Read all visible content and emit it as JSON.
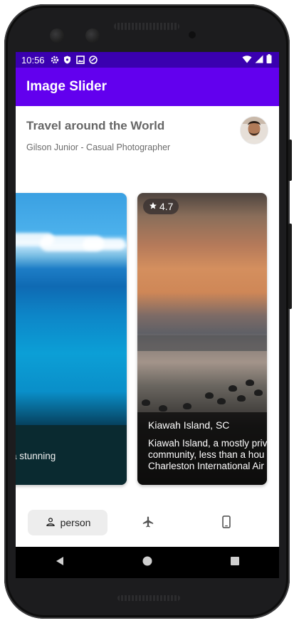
{
  "status_bar": {
    "time": "10:56",
    "icons": [
      "settings-icon",
      "shield-icon",
      "image-icon",
      "sync-icon",
      "wifi-icon",
      "signal-icon",
      "battery-icon"
    ]
  },
  "app_bar": {
    "title": "Image Slider"
  },
  "header": {
    "title": "Travel around the World",
    "subtitle": "Gilson Junior - Casual Photographer"
  },
  "slides": [
    {
      "title": "",
      "description_visible": "ny a stunning"
    },
    {
      "rating": "4.7",
      "title": "Kiawah Island, SC",
      "description_lines": [
        "Kiawah Island, a mostly priv",
        "community, less than a hou",
        "Charleston International Air"
      ]
    }
  ],
  "bottom_nav": {
    "items": [
      {
        "label": "person",
        "icon": "person-icon",
        "selected": true
      },
      {
        "label": "",
        "icon": "airplane-icon",
        "selected": false
      },
      {
        "label": "",
        "icon": "phone-icon",
        "selected": false
      }
    ]
  },
  "colors": {
    "status_bar": "#3a00b0",
    "app_bar": "#6200ee",
    "nav_selected_bg": "#ededed"
  }
}
